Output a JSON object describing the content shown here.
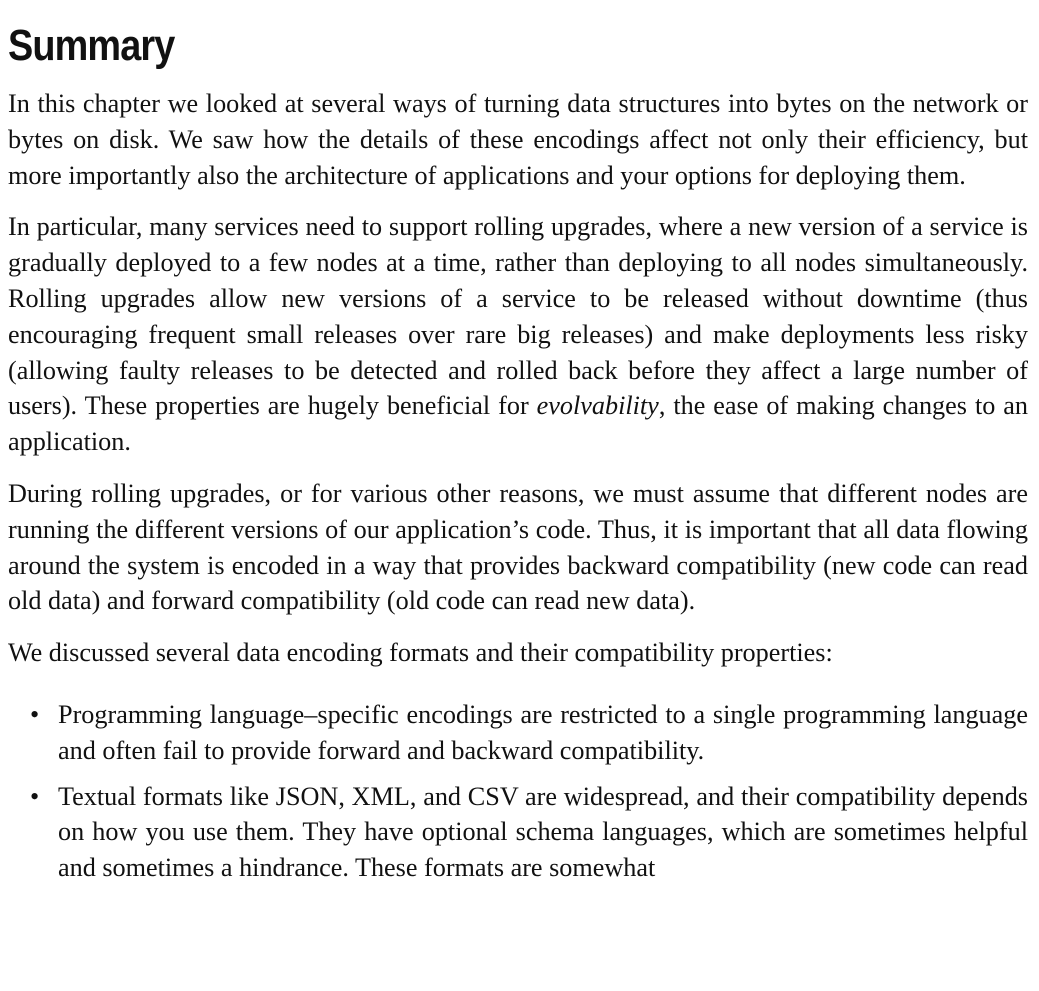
{
  "heading": "Summary",
  "paragraphs": {
    "p1": "In this chapter we looked at several ways of turning data structures into bytes on the network or bytes on disk. We saw how the details of these encodings affect not only their efficiency, but more importantly also the architecture of applications and your options for deploying them.",
    "p2_before": "In particular, many services need to support rolling upgrades, where a new version of a service is gradually deployed to a few nodes at a time, rather than deploying to all nodes simultaneously. Rolling upgrades allow new versions of a service to be released without downtime (thus encouraging frequent small releases over rare big releases) and make deployments less risky (allowing faulty releases to be detected and rolled back before they affect a large number of users). These properties are hugely beneficial for ",
    "p2_em": "evolvability",
    "p2_after": ", the ease of making changes to an application.",
    "p3": "During rolling upgrades, or for various other reasons, we must assume that different nodes are running the different versions of our application’s code. Thus, it is important that all data flowing around the system is encoded in a way that provides backward compatibility (new code can read old data) and forward compatibility (old code can read new data).",
    "p4": "We discussed several data encoding formats and their compatibility properties:"
  },
  "bullet_symbol": "•",
  "list": [
    "Programming language–specific encodings are restricted to a single programming language and often fail to provide forward and backward compatibility.",
    "Textual formats like JSON, XML, and CSV are widespread, and their compatibility depends on how you use them. They have optional schema languages, which are sometimes helpful and sometimes a hindrance. These formats are somewhat"
  ]
}
